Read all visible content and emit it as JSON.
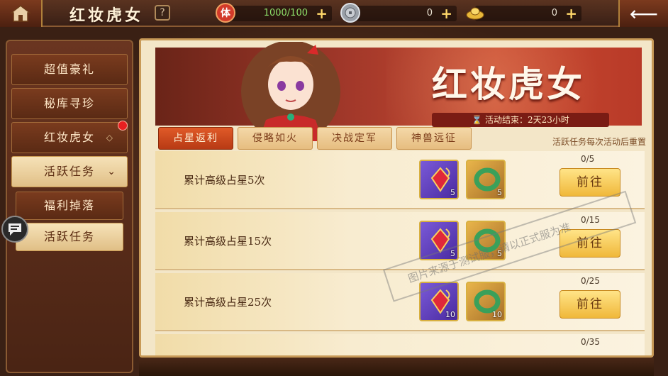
{
  "header": {
    "title": "红妆虎女",
    "help_label": "?",
    "resources": [
      {
        "icon": "ti-stamina-icon",
        "icon_label": "体",
        "value": "1000/100",
        "color": "#d23a2a"
      },
      {
        "icon": "silver-coin-icon",
        "icon_label": "",
        "value": "0",
        "color": "#9aa0a8"
      },
      {
        "icon": "gold-ingot-icon",
        "icon_label": "",
        "value": "0",
        "color": "#e8b83a"
      }
    ],
    "plus_label": "+",
    "back_label": "⟵"
  },
  "sidebar": {
    "items": [
      {
        "label": "超值豪礼",
        "active": false
      },
      {
        "label": "秘库寻珍",
        "active": false
      },
      {
        "label": "红妆虎女",
        "active": false
      },
      {
        "label": "活跃任务",
        "active": true
      },
      {
        "label": "福利掉落",
        "active": false
      },
      {
        "label": "活跃任务",
        "active": true
      }
    ]
  },
  "banner": {
    "title": "红妆虎女",
    "time_text": "活动结束：2天23小时"
  },
  "tabs": [
    {
      "label": "占星返利",
      "active": true
    },
    {
      "label": "侵略如火",
      "active": false
    },
    {
      "label": "决战定军",
      "active": false
    },
    {
      "label": "神兽远征",
      "active": false
    }
  ],
  "reset_note": "活跃任务每次活动后重置",
  "tasks": [
    {
      "name": "累计高级占星5次",
      "progress": "0/5",
      "rewards": [
        {
          "icon": "ruby-amulet-icon",
          "count": "5"
        },
        {
          "icon": "jade-bracelet-icon",
          "count": "5"
        }
      ],
      "button": "前往"
    },
    {
      "name": "累计高级占星15次",
      "progress": "0/15",
      "rewards": [
        {
          "icon": "ruby-amulet-icon",
          "count": "5"
        },
        {
          "icon": "jade-bracelet-icon",
          "count": "5"
        }
      ],
      "button": "前往"
    },
    {
      "name": "累计高级占星25次",
      "progress": "0/25",
      "rewards": [
        {
          "icon": "ruby-amulet-icon",
          "count": "10"
        },
        {
          "icon": "jade-bracelet-icon",
          "count": "10"
        }
      ],
      "button": "前往"
    },
    {
      "name": "",
      "progress": "0/35",
      "rewards": [],
      "button": ""
    }
  ],
  "watermark": "图片来源于测试服，请以正式服为准"
}
